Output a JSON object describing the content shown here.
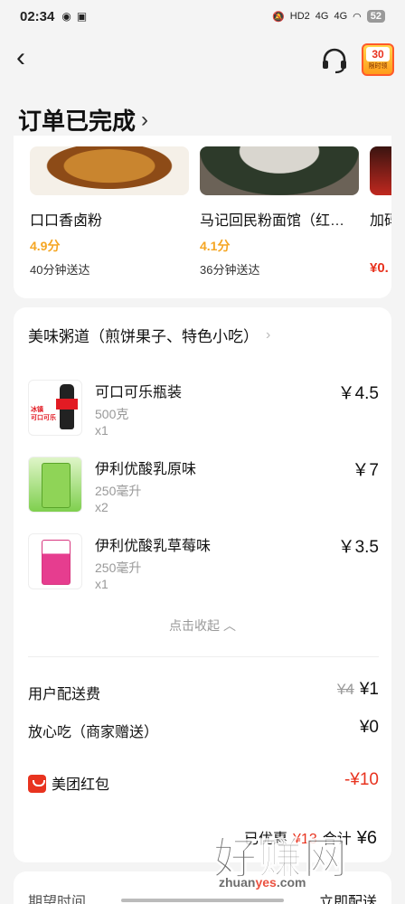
{
  "status_bar": {
    "time": "02:34",
    "battery": "52",
    "net1": "4G",
    "net2": "4G",
    "hd": "HD2"
  },
  "header": {
    "coupon_value": "30",
    "coupon_text": "限时领"
  },
  "page_title": "订单已完成",
  "recommendations": [
    {
      "name": "口口香卤粉",
      "score": "4.9分",
      "delivery": "40分钟送达"
    },
    {
      "name": "马记回民粉面馆（红…",
      "score": "4.1分",
      "delivery": "36分钟送达"
    },
    {
      "name": "加码",
      "price": "¥0."
    }
  ],
  "order": {
    "shop_name": "美味粥道（煎饼果子、特色小吃）",
    "items": [
      {
        "name": "可口可乐瓶装",
        "spec": "500克",
        "qty": "x1",
        "price": "￥4.5",
        "thumb_text": "冰镇\n可口可乐"
      },
      {
        "name": "伊利优酸乳原味",
        "spec": "250毫升",
        "qty": "x2",
        "price": "￥7"
      },
      {
        "name": "伊利优酸乳草莓味",
        "spec": "250毫升",
        "qty": "x1",
        "price": "￥3.5"
      }
    ],
    "collapse_label": "点击收起",
    "fees": {
      "delivery_label": "用户配送费",
      "delivery_original": "¥4",
      "delivery_value": "¥1",
      "assurance_label": "放心吃（商家赠送）",
      "assurance_value": "¥0",
      "redpack_label": "美团红包",
      "redpack_value": "-¥10"
    },
    "summary": {
      "discount_label": "已优惠",
      "discount_value": "¥13",
      "total_label": "合计",
      "total_value": "¥6"
    }
  },
  "delivery": {
    "label": "期望时间",
    "value": "立即配送"
  },
  "watermark": {
    "text": "好赚网",
    "url_pre": "zhuan",
    "url_hl": "yes",
    "url_post": ".com"
  }
}
